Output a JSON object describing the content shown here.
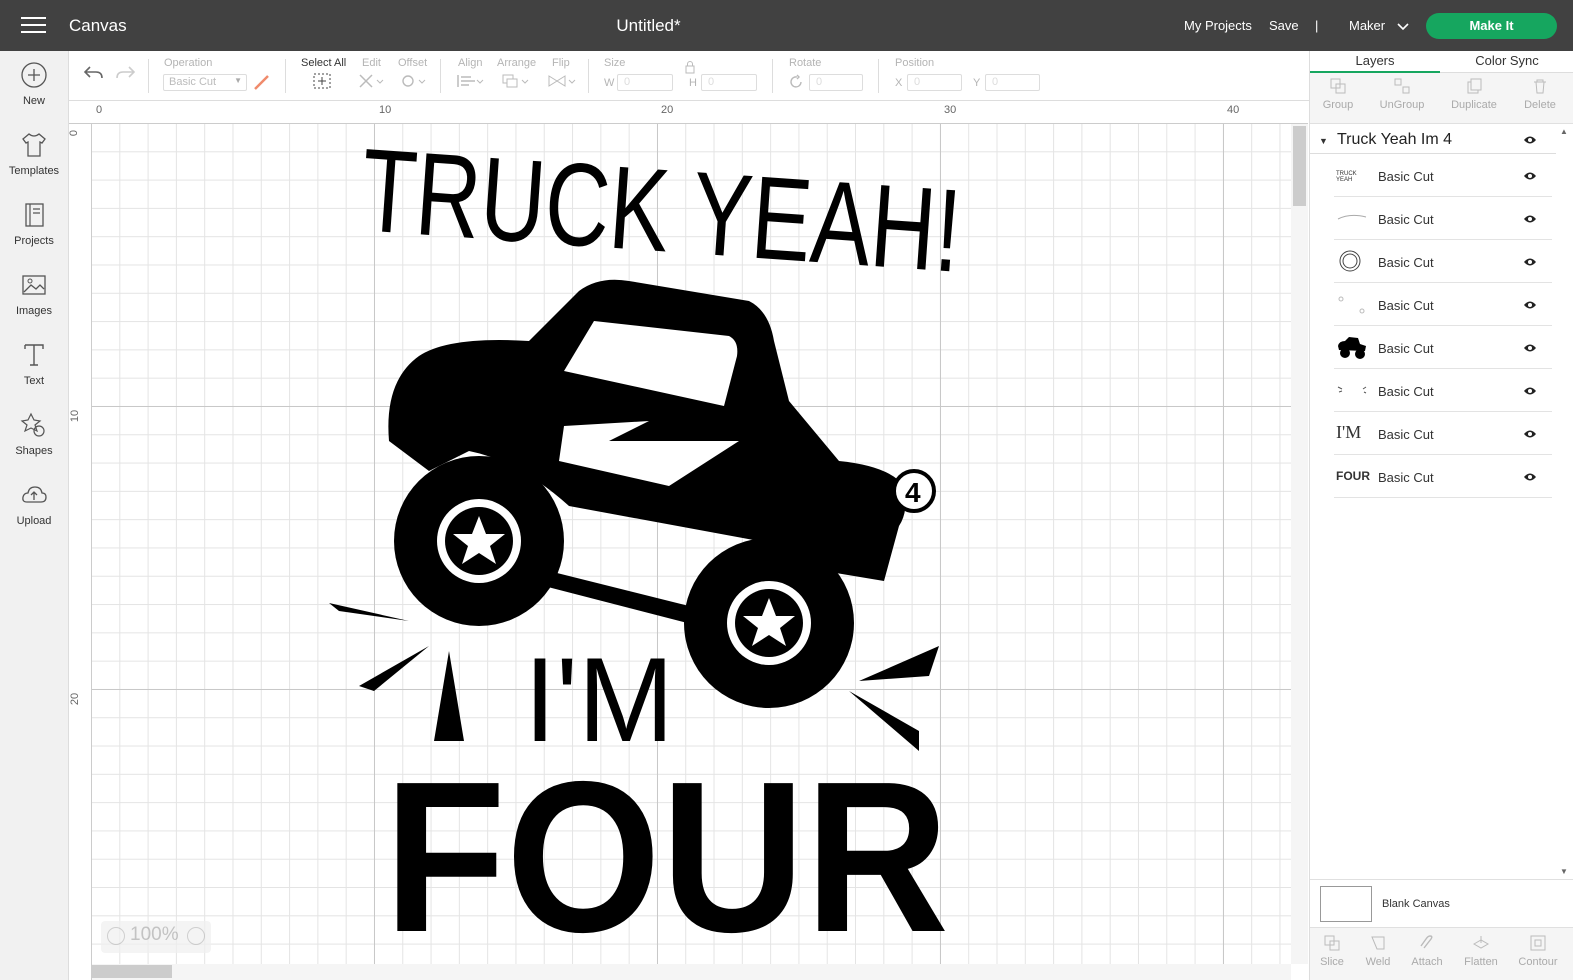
{
  "topbar": {
    "app_title": "Canvas",
    "doc_title": "Untitled*",
    "my_projects": "My Projects",
    "save": "Save",
    "divider": "|",
    "machine": "Maker",
    "make_it": "Make It"
  },
  "leftnav": {
    "items": [
      {
        "label": "New",
        "icon": "plus-circle-icon"
      },
      {
        "label": "Templates",
        "icon": "tshirt-icon"
      },
      {
        "label": "Projects",
        "icon": "book-icon"
      },
      {
        "label": "Images",
        "icon": "image-icon"
      },
      {
        "label": "Text",
        "icon": "text-icon"
      },
      {
        "label": "Shapes",
        "icon": "shapes-icon"
      },
      {
        "label": "Upload",
        "icon": "cloud-upload-icon"
      }
    ]
  },
  "editbar": {
    "operation_label": "Operation",
    "operation_value": "Basic Cut",
    "select_all": "Select All",
    "edit": "Edit",
    "offset": "Offset",
    "align": "Align",
    "arrange": "Arrange",
    "flip": "Flip",
    "size": "Size",
    "w": "W",
    "h": "H",
    "w_value": "0",
    "h_value": "0",
    "rotate": "Rotate",
    "rotate_value": "0",
    "position": "Position",
    "x": "X",
    "y": "Y",
    "x_value": "0",
    "y_value": "0"
  },
  "canvas": {
    "ruler_top": [
      "0",
      "10",
      "20",
      "30",
      "40"
    ],
    "ruler_left": [
      "0",
      "10",
      "20"
    ],
    "zoom": "100%",
    "artwork": {
      "line1": "TRUCK YEAH!",
      "line2": "I'M",
      "line3": "FOUR",
      "number": "4"
    }
  },
  "rightpanel": {
    "tabs": [
      "Layers",
      "Color Sync"
    ],
    "tools": [
      "Group",
      "UnGroup",
      "Duplicate",
      "Delete"
    ],
    "group_name": "Truck Yeah Im 4",
    "layers": [
      {
        "name": "Basic Cut",
        "thumb": "TRUCK YEAH"
      },
      {
        "name": "Basic Cut",
        "thumb": ""
      },
      {
        "name": "Basic Cut",
        "thumb": "4"
      },
      {
        "name": "Basic Cut",
        "thumb": ""
      },
      {
        "name": "Basic Cut",
        "thumb": ""
      },
      {
        "name": "Basic Cut",
        "thumb": ""
      },
      {
        "name": "Basic Cut",
        "thumb": "I'M"
      },
      {
        "name": "Basic Cut",
        "thumb": "FOUR"
      }
    ],
    "blank_canvas": "Blank Canvas",
    "bottom_tools": [
      "Slice",
      "Weld",
      "Attach",
      "Flatten",
      "Contour"
    ]
  }
}
